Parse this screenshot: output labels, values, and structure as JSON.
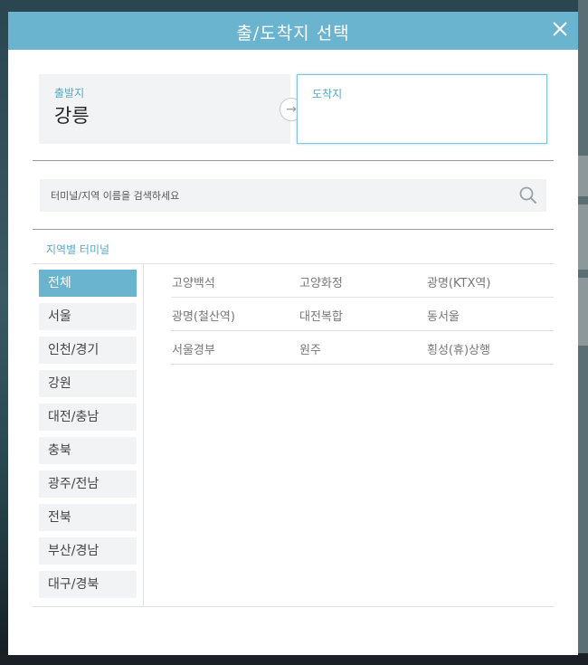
{
  "modal": {
    "title": "출/도착지 선택"
  },
  "route": {
    "origin_label": "출발지",
    "origin_value": "강릉",
    "destination_label": "도착지",
    "destination_value": ""
  },
  "search": {
    "placeholder": "터미널/지역 이름을 검색하세요"
  },
  "region_section": {
    "title": "지역별 터미널"
  },
  "regions": [
    "전체",
    "서울",
    "인천/경기",
    "강원",
    "대전/충남",
    "충북",
    "광주/전남",
    "전북",
    "부산/경남",
    "대구/경북"
  ],
  "active_region": "전체",
  "terminals": [
    [
      "고양백석",
      "고양화정",
      "광명(KTX역)"
    ],
    [
      "광명(철산역)",
      "대전복합",
      "동서울"
    ],
    [
      "서울경부",
      "원주",
      "횡성(휴)상행"
    ]
  ],
  "colors": {
    "accent": "#6ab4cf",
    "panel": "#f2f3f4"
  }
}
